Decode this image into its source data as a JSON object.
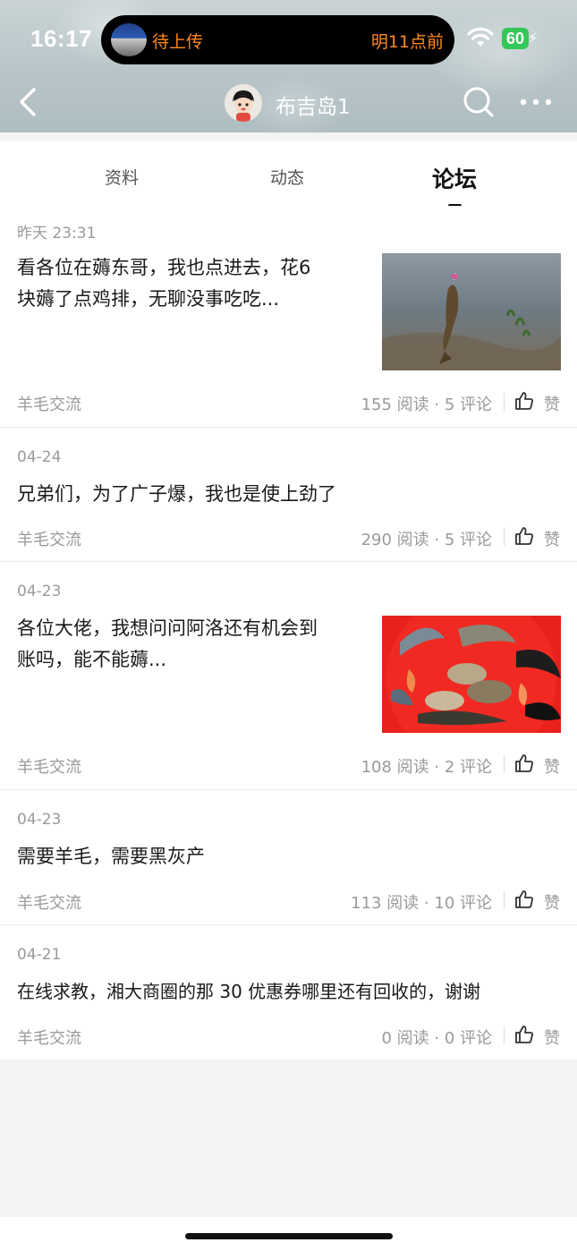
{
  "status_bar": {
    "time": "16:17",
    "island_left": "待上传",
    "island_right": "明11点前",
    "battery": "60",
    "icons": [
      "wifi-icon",
      "battery-icon",
      "charging-bolt-icon"
    ]
  },
  "nav": {
    "title": "布吉岛1",
    "icons": [
      "back-chevron-icon",
      "avatar",
      "search-icon",
      "more-icon"
    ]
  },
  "tabs": [
    {
      "label": "资料",
      "active": false
    },
    {
      "label": "动态",
      "active": false
    },
    {
      "label": "论坛",
      "active": true
    }
  ],
  "posts": [
    {
      "date": "昨天 23:31",
      "text_line1": "看各位在薅东哥，我也点进去，花6",
      "text_line2": "块薅了点鸡排，无聊没事吃吃...",
      "has_image": true,
      "category": "羊毛交流",
      "stats": "155 阅读 · 5 评论",
      "like": "赞"
    },
    {
      "date": "04-24",
      "text_line1": "兄弟们，为了广子爆，我也是使上劲了",
      "text_line2": "",
      "has_image": false,
      "category": "羊毛交流",
      "stats": "290 阅读 · 5 评论",
      "like": "赞"
    },
    {
      "date": "04-23",
      "text_line1": "各位大佬，我想问问阿洛还有机会到",
      "text_line2": "账吗，能不能薅...",
      "has_image": true,
      "category": "羊毛交流",
      "stats": "108 阅读 · 2 评论",
      "like": "赞"
    },
    {
      "date": "04-23",
      "text_line1": "需要羊毛，需要黑灰产",
      "text_line2": "",
      "has_image": false,
      "category": "羊毛交流",
      "stats": "113 阅读 · 10 评论",
      "like": "赞"
    },
    {
      "date": "04-21",
      "text_line1": "在线求教，湘大商圈的那 30 优惠券哪里还有回收的，谢谢",
      "text_line2": "",
      "has_image": false,
      "category": "羊毛交流",
      "stats": "0 阅读 · 0 评论",
      "like": "赞"
    }
  ]
}
